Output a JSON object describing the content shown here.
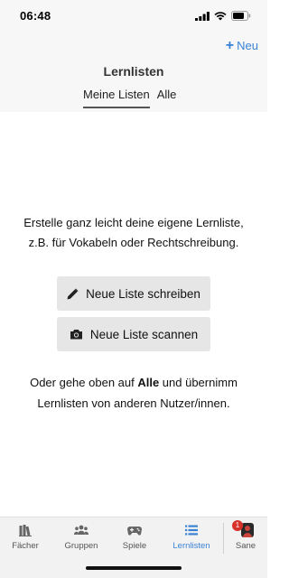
{
  "status_bar": {
    "time": "06:48"
  },
  "header": {
    "new_button": {
      "icon": "plus-icon",
      "label": "Neu"
    },
    "title": "Lernlisten",
    "tabs": [
      {
        "label": "Meine Listen",
        "active": true
      },
      {
        "label": "Alle",
        "active": false
      }
    ]
  },
  "main": {
    "intro_line1": "Erstelle ganz leicht deine eigene Lernliste,",
    "intro_line2": "z.B. für Vokabeln oder Rechtschreibung.",
    "write_button": {
      "icon": "pencil-icon",
      "label": "Neue Liste schreiben"
    },
    "scan_button": {
      "icon": "camera-icon",
      "label": "Neue Liste scannen"
    },
    "hint_prefix": "Oder gehe oben auf ",
    "hint_bold": "Alle",
    "hint_suffix": " und übernimm",
    "hint_line2": "Lernlisten von anderen Nutzer/innen."
  },
  "tabbar": {
    "items": [
      {
        "label": "Fächer",
        "icon": "books-icon",
        "active": false
      },
      {
        "label": "Gruppen",
        "icon": "people-icon",
        "active": false
      },
      {
        "label": "Spiele",
        "icon": "gamepad-icon",
        "active": false
      },
      {
        "label": "Lernlisten",
        "icon": "list-icon",
        "active": true
      },
      {
        "label": "Sane",
        "icon": "avatar-icon",
        "active": false,
        "badge": "1"
      }
    ]
  },
  "colors": {
    "accent": "#3a82d6",
    "header_bg": "#f7f7f7",
    "button_bg": "#e6e6e6",
    "badge": "#d6312b"
  }
}
